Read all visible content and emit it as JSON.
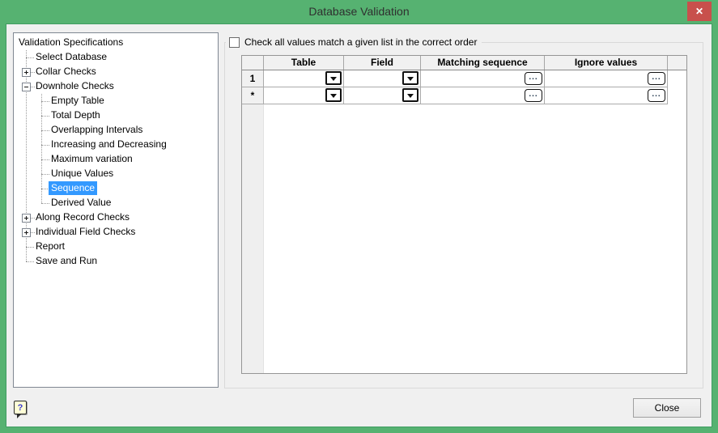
{
  "window": {
    "title": "Database Validation",
    "close_glyph": "✕"
  },
  "colors": {
    "titlebar_green": "#56b271",
    "close_red": "#c8504c",
    "selection_blue": "#3399ff",
    "dialog_bg": "#f0f0f0"
  },
  "tree": {
    "items": [
      {
        "label": "Validation Specifications",
        "level": 0,
        "glyph": "none",
        "selected": false
      },
      {
        "label": "Select Database",
        "level": 1,
        "glyph": "leaf",
        "selected": false
      },
      {
        "label": "Collar Checks",
        "level": 1,
        "glyph": "plus",
        "selected": false
      },
      {
        "label": "Downhole Checks",
        "level": 1,
        "glyph": "minus",
        "selected": false
      },
      {
        "label": "Empty Table",
        "level": 2,
        "glyph": "leaf",
        "selected": false
      },
      {
        "label": "Total Depth",
        "level": 2,
        "glyph": "leaf",
        "selected": false
      },
      {
        "label": "Overlapping Intervals",
        "level": 2,
        "glyph": "leaf",
        "selected": false
      },
      {
        "label": "Increasing and Decreasing",
        "level": 2,
        "glyph": "leaf",
        "selected": false
      },
      {
        "label": "Maximum variation",
        "level": 2,
        "glyph": "leaf",
        "selected": false
      },
      {
        "label": "Unique Values",
        "level": 2,
        "glyph": "leaf",
        "selected": false
      },
      {
        "label": "Sequence",
        "level": 2,
        "glyph": "leaf",
        "selected": true
      },
      {
        "label": "Derived Value",
        "level": 2,
        "glyph": "leaf",
        "selected": false
      },
      {
        "label": "Along Record Checks",
        "level": 1,
        "glyph": "plus",
        "selected": false
      },
      {
        "label": "Individual Field Checks",
        "level": 1,
        "glyph": "plus",
        "selected": false
      },
      {
        "label": "Report",
        "level": 1,
        "glyph": "leaf",
        "selected": false
      },
      {
        "label": "Save and Run",
        "level": 1,
        "glyph": "leaf",
        "selected": false
      }
    ]
  },
  "options": {
    "checkbox_label": "Check all values match a given list in the correct order",
    "checkbox_checked": false
  },
  "grid": {
    "columns": [
      "Table",
      "Field",
      "Matching sequence",
      "Ignore values"
    ],
    "rows": [
      {
        "header": "1"
      },
      {
        "header": "*"
      }
    ],
    "ellipsis_label": "..."
  },
  "footer": {
    "close_label": "Close",
    "help_glyph": "?"
  }
}
